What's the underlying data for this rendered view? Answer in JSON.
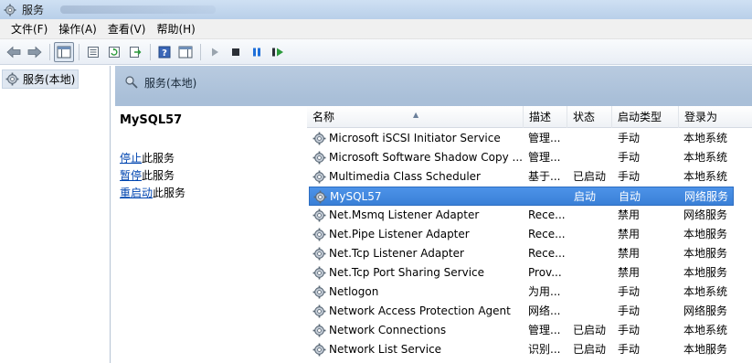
{
  "window": {
    "title": "服务"
  },
  "menu": {
    "items": [
      "文件(F)",
      "操作(A)",
      "查看(V)",
      "帮助(H)"
    ]
  },
  "tree": {
    "root_label": "服务(本地)"
  },
  "panel_header": {
    "label": "服务(本地)"
  },
  "description": {
    "service_name": "MySQL57",
    "actions": [
      {
        "link": "停止",
        "suffix": "此服务"
      },
      {
        "link": "暂停",
        "suffix": "此服务"
      },
      {
        "link": "重启动",
        "suffix": "此服务"
      }
    ]
  },
  "list": {
    "columns": [
      "名称",
      "描述",
      "状态",
      "启动类型",
      "登录为"
    ],
    "selected_index": 3,
    "rows": [
      {
        "name": "Microsoft iSCSI Initiator Service",
        "desc": "管理...",
        "status": "",
        "startup": "手动",
        "logon": "本地系统"
      },
      {
        "name": "Microsoft Software Shadow Copy ...",
        "desc": "管理...",
        "status": "",
        "startup": "手动",
        "logon": "本地系统"
      },
      {
        "name": "Multimedia Class Scheduler",
        "desc": "基于...",
        "status": "已启动",
        "startup": "手动",
        "logon": "本地系统"
      },
      {
        "name": "MySQL57",
        "desc": "",
        "status": "启动",
        "startup": "自动",
        "logon": "网络服务"
      },
      {
        "name": "Net.Msmq Listener Adapter",
        "desc": "Rece...",
        "status": "",
        "startup": "禁用",
        "logon": "网络服务"
      },
      {
        "name": "Net.Pipe Listener Adapter",
        "desc": "Rece...",
        "status": "",
        "startup": "禁用",
        "logon": "本地服务"
      },
      {
        "name": "Net.Tcp Listener Adapter",
        "desc": "Rece...",
        "status": "",
        "startup": "禁用",
        "logon": "本地服务"
      },
      {
        "name": "Net.Tcp Port Sharing Service",
        "desc": "Prov...",
        "status": "",
        "startup": "禁用",
        "logon": "本地服务"
      },
      {
        "name": "Netlogon",
        "desc": "为用...",
        "status": "",
        "startup": "手动",
        "logon": "本地系统"
      },
      {
        "name": "Network Access Protection Agent",
        "desc": "网络...",
        "status": "",
        "startup": "手动",
        "logon": "网络服务"
      },
      {
        "name": "Network Connections",
        "desc": "管理...",
        "status": "已启动",
        "startup": "手动",
        "logon": "本地系统"
      },
      {
        "name": "Network List Service",
        "desc": "识别...",
        "status": "已启动",
        "startup": "手动",
        "logon": "本地服务"
      }
    ]
  },
  "colors": {
    "link": "#0045b0",
    "selection": "#3a80d7",
    "header_band": "#a9bfd8"
  }
}
